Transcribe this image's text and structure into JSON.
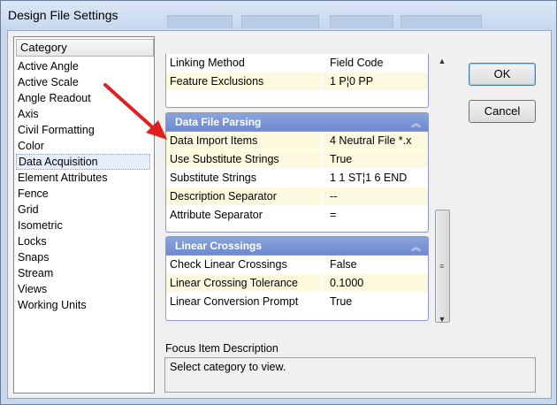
{
  "window": {
    "title": "Design File Settings"
  },
  "category": {
    "header": "Category",
    "items": [
      "Active Angle",
      "Active Scale",
      "Angle Readout",
      "Axis",
      "Civil Formatting",
      "Color",
      "Data Acquisition",
      "Element Attributes",
      "Fence",
      "Grid",
      "Isometric",
      "Locks",
      "Snaps",
      "Stream",
      "Views",
      "Working Units"
    ],
    "selected": "Data Acquisition"
  },
  "group_top": {
    "rows": [
      {
        "name": "Linking Method",
        "value": "Field Code"
      },
      {
        "name": "Feature  Exclusions",
        "value": "1 P¦0 PP"
      }
    ]
  },
  "group_parsing": {
    "title": "Data File Parsing",
    "rows": [
      {
        "name": "Data Import Items",
        "value": "4  Neutral File *.x"
      },
      {
        "name": "Use Substitute Strings",
        "value": "True"
      },
      {
        "name": "Substitute Strings",
        "value": "1 1 ST¦1 6 END"
      },
      {
        "name": "Description Separator",
        "value": "--"
      },
      {
        "name": "Attribute Separator",
        "value": "="
      }
    ]
  },
  "group_linear": {
    "title": "Linear Crossings",
    "rows": [
      {
        "name": "Check Linear Crossings",
        "value": "False"
      },
      {
        "name": "Linear Crossing Tolerance",
        "value": "0.1000"
      },
      {
        "name": "Linear Conversion Prompt",
        "value": "True"
      }
    ]
  },
  "buttons": {
    "ok": "OK",
    "cancel": "Cancel"
  },
  "focus": {
    "label": "Focus Item Description",
    "text": "Select category to view."
  },
  "icons": {
    "collapse": "collapse-chevrons-icon",
    "arrow": "red-arrow-annotation"
  },
  "colors": {
    "accent": "#6d8ed6",
    "alt_row": "#fdf9df",
    "arrow": "#e02020"
  }
}
